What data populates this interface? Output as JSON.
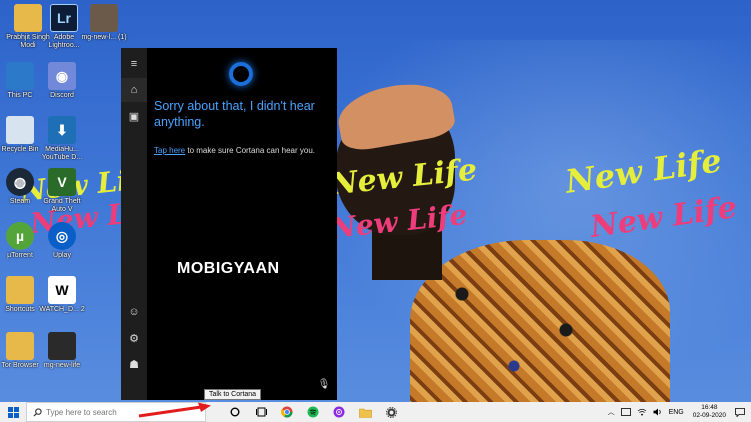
{
  "desktop": {
    "icons": [
      {
        "label": "Prabhjit Singh Modi",
        "glyph": "📁",
        "color": "#e7b84a"
      },
      {
        "label": "Adobe Lightroo...",
        "glyph": "Lr",
        "color": "#0d1d35"
      },
      {
        "label": "mg-new-l... (1)",
        "glyph": "",
        "color": "#6b5a4a"
      },
      {
        "label": "This PC",
        "glyph": "🖥",
        "color": "#2c79c9"
      },
      {
        "label": "Discord",
        "glyph": "◉",
        "color": "#7289da"
      },
      {
        "label": "Recycle Bin",
        "glyph": "🗑",
        "color": "#d7e4ef"
      },
      {
        "label": "MediaHu... YouTube D...",
        "glyph": "⬇",
        "color": "#1f6fb7"
      },
      {
        "label": "Steam",
        "glyph": "◍",
        "color": "#1b2838"
      },
      {
        "label": "Grand Theft Auto V",
        "glyph": "V",
        "color": "#2a6b2a"
      },
      {
        "label": "µTorrent",
        "glyph": "µ",
        "color": "#53a53a"
      },
      {
        "label": "Uplay",
        "glyph": "◎",
        "color": "#0a5ec7"
      },
      {
        "label": "Shortcuts",
        "glyph": "📁",
        "color": "#e7b84a"
      },
      {
        "label": "WATCH_D... 2",
        "glyph": "W",
        "color": "#ffffff"
      },
      {
        "label": "Tor Browser",
        "glyph": "📁",
        "color": "#e7b84a"
      },
      {
        "label": "mg-new-life",
        "glyph": "",
        "color": "#2a2a2a"
      }
    ]
  },
  "wallpaper": {
    "script_lines": [
      "New Life",
      "New Life",
      "New Life",
      "New Life",
      "New Life",
      "New Life"
    ]
  },
  "cortana": {
    "message": "Sorry about that, I didn't hear anything.",
    "link_text": "Tap here",
    "sub_text": " to make sure Cortana can hear you.",
    "rail": {
      "menu": "≡",
      "home": "⌂",
      "notebook": "▣",
      "account": "☺",
      "settings": "⚙",
      "feedback": "☗"
    },
    "mic": "🎙"
  },
  "watermark": "MOBIGYAAN",
  "tooltip": "Talk to Cortana",
  "taskbar": {
    "search_placeholder": "Type here to search",
    "tray_lang": "ENG",
    "time": "16:48",
    "date": "02-09-2020",
    "apps": [
      "task-view",
      "chrome",
      "spotify",
      "podcast",
      "file-explorer",
      "settings"
    ]
  },
  "colors": {
    "cortana_blue": "#4ba2ff",
    "arrow_red": "#e21c1c",
    "taskbar_bg": "#f0f0f0"
  }
}
